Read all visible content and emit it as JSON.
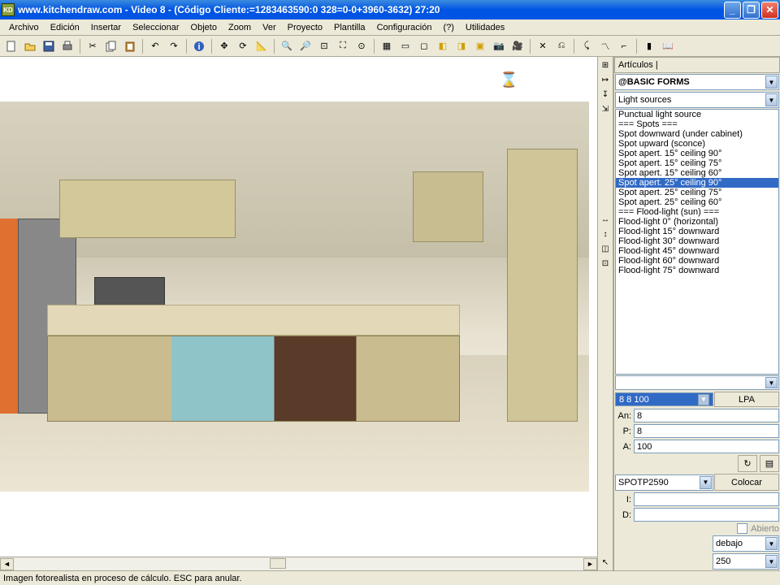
{
  "title": "www.kitchendraw.com - Video 8 - (Código Cliente:=1283463590:0 328=0-0+3960-3632) 27:20",
  "app_icon": "KD",
  "menu": [
    "Archivo",
    "Edición",
    "Insertar",
    "Seleccionar",
    "Objeto",
    "Zoom",
    "Ver",
    "Proyecto",
    "Plantilla",
    "Configuración",
    "(?)",
    "Utilidades"
  ],
  "side": {
    "header": "Artículos",
    "catalog": "@BASIC FORMS",
    "category": "Light sources",
    "items": [
      "Punctual light source",
      "=== Spots ===",
      "Spot downward (under cabinet)",
      "Spot upward (sconce)",
      "Spot apert. 15° ceiling 90°",
      "Spot apert. 15° ceiling 75°",
      "Spot apert. 15° ceiling 60°",
      "Spot apert. 25° ceiling 90°",
      "Spot apert. 25° ceiling 75°",
      "Spot apert. 25° ceiling 60°",
      "=== Flood-light (sun) ===",
      "Flood-light 0° (horizontal)",
      "Flood-light 15° downward",
      "Flood-light 30° downward",
      "Flood-light 45° downward",
      "Flood-light 60° downward",
      "Flood-light 75° downward"
    ],
    "selected_index": 7,
    "dims_blue": "8   8 100",
    "lpa": "LPA",
    "an_label": "An:",
    "an_val": "8",
    "p_label": "P:",
    "p_val": "8",
    "a_label": "A:",
    "a_val": "100",
    "ref": "SPOTP2590",
    "colocar": "Colocar",
    "i_label": "I:",
    "i_val": "",
    "d_label": "D:",
    "d_val": "",
    "abierto": "Abierto",
    "pos": "debajo",
    "height": "250"
  },
  "status": "Imagen fotorealista en proceso de cálculo. ESC para anular."
}
